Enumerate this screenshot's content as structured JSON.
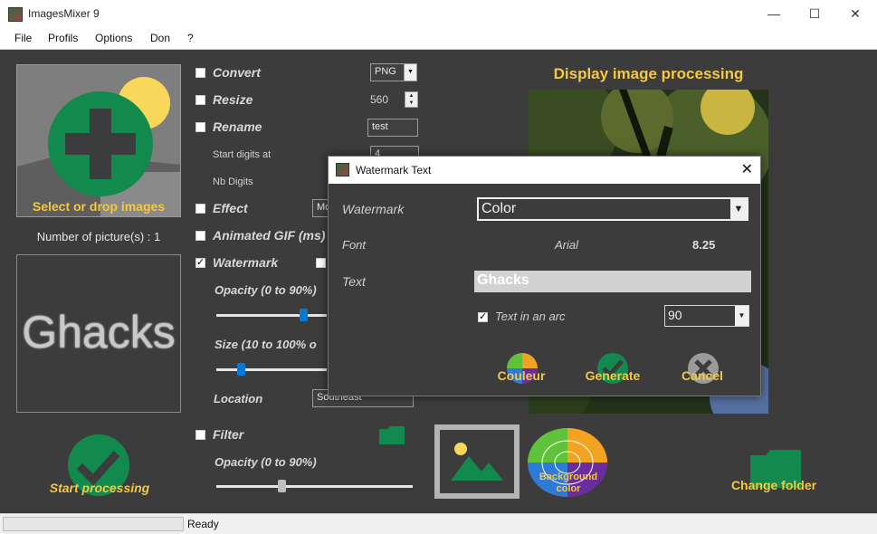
{
  "window": {
    "title": "ImagesMixer 9",
    "minimize": "—",
    "maximize": "☐",
    "close": "✕"
  },
  "menu": [
    "File",
    "Profils",
    "Options",
    "Don",
    "?"
  ],
  "left": {
    "drop_label": "Select or drop images",
    "count_label": "Number of picture(s) : 1",
    "preview_text": "Ghacks"
  },
  "options": {
    "convert": {
      "label": "Convert",
      "value": "PNG"
    },
    "resize": {
      "label": "Resize",
      "value": "560"
    },
    "rename": {
      "label": "Rename",
      "value": "test",
      "start_label": "Start digits at",
      "start_value": "4",
      "nb_label": "Nb Digits"
    },
    "effect": {
      "label": "Effect",
      "value": "Mo"
    },
    "gif": {
      "label": "Animated GIF (ms)"
    },
    "watermark": {
      "label": "Watermark",
      "checked": true
    },
    "opacity": {
      "label": "Opacity (0 to 90%)",
      "level": 0.44
    },
    "size": {
      "label": "Size (10 to 100% o",
      "level": 0.22
    },
    "location": {
      "label": "Location",
      "value": "Southeast"
    },
    "filter": {
      "label": "Filter"
    },
    "filter_opacity": {
      "label": "Opacity (0 to 90%)",
      "level": 0.34
    }
  },
  "display": {
    "title": "Display image processing"
  },
  "buttons": {
    "start": "Start processing",
    "change_folder": "Change folder",
    "background": "Background",
    "background2": "color"
  },
  "status": {
    "text": "Ready"
  },
  "dialog": {
    "title": "Watermark Text",
    "close": "✕",
    "watermark_label": "Watermark",
    "watermark_value": "Color",
    "font_label": "Font",
    "font_name": "Arial",
    "font_size": "8.25",
    "text_label": "Text",
    "text_value": "Ghacks",
    "arc_label": "Text in an arc",
    "arc_checked": true,
    "arc_value": "90",
    "couleur": "Couleur",
    "generate": "Generate",
    "cancel": "Cancel"
  },
  "colors": {
    "accent": "#f5c842",
    "green": "#138a4d",
    "bg": "#3c3c3c"
  }
}
